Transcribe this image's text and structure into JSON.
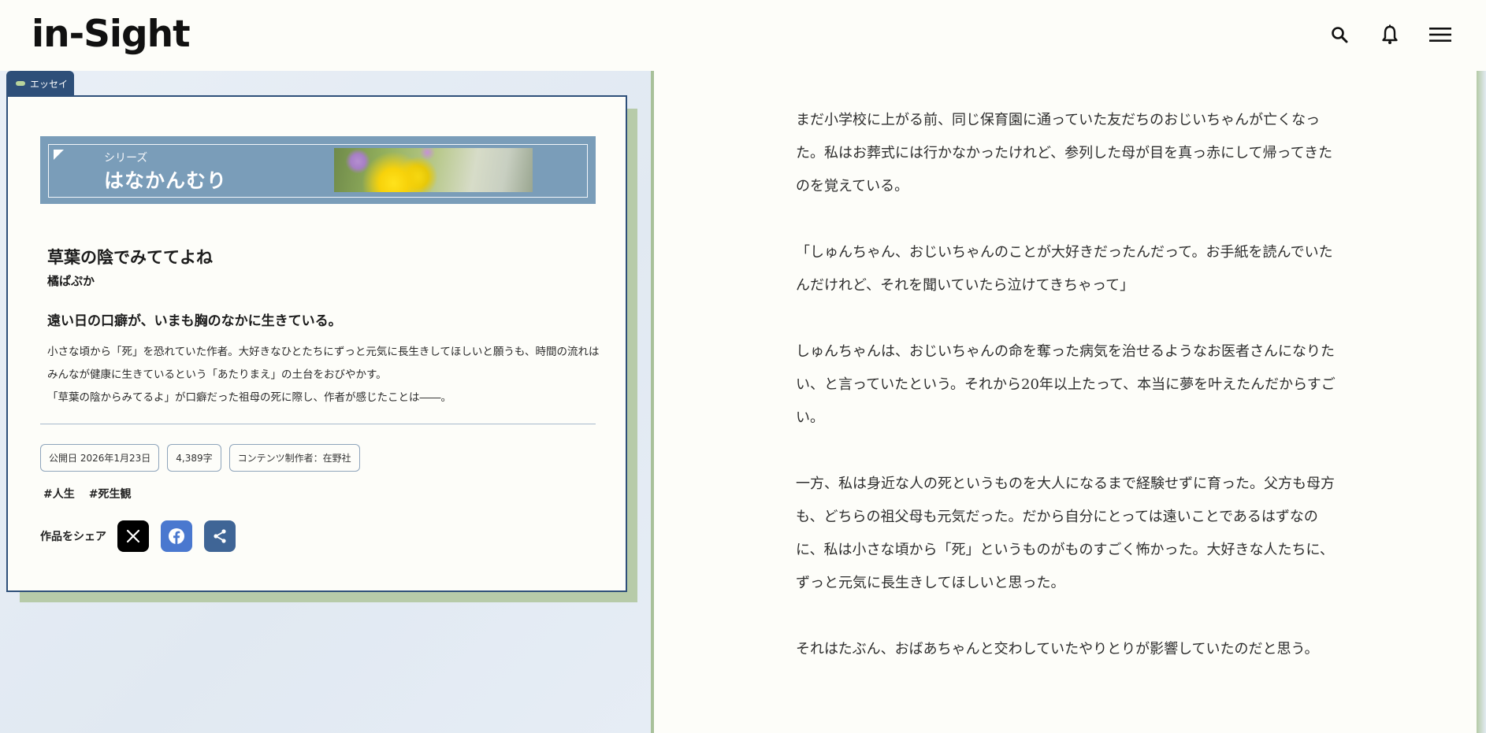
{
  "header": {
    "logo": "in-Sight",
    "icons": [
      "search-icon",
      "bell-icon",
      "menu-icon"
    ]
  },
  "category_tag": "エッセイ",
  "series": {
    "label": "シリーズ",
    "title": "はなかんむり"
  },
  "work": {
    "title": "草葉の陰でみててよね",
    "author": "橘ぱぷか",
    "catch": "遠い日の口癖が、いまも胸のなかに生きている。",
    "description": [
      "小さな頃から「死」を恐れていた作者。大好きなひとたちにずっと元気に長生きしてほしいと願うも、時間の流れはみんなが健康に生きているという「あたりまえ」の土台をおびやかす。",
      "「草葉の陰からみてるよ」が口癖だった祖母の死に際し、作者が感じたことは――。"
    ]
  },
  "meta": {
    "published": "公開日 2026年1月23日",
    "chars": "4,389字",
    "producer": "コンテンツ制作者：在野社"
  },
  "hashtags": [
    "#人生",
    "#死生観"
  ],
  "share": {
    "label": "作品をシェア",
    "buttons": [
      "x-icon",
      "facebook-icon",
      "share-icon"
    ]
  },
  "article": {
    "paragraphs": [
      "まだ小学校に上がる前、同じ保育園に通っていた友だちのおじいちゃんが亡くなった。私はお葬式には行かなかったけれど、参列した母が目を真っ赤にして帰ってきたのを覚えている。",
      "「しゅんちゃん、おじいちゃんのことが大好きだったんだって。お手紙を読んでいたんだけれど、それを聞いていたら泣けてきちゃって」",
      "しゅんちゃんは、おじいちゃんの命を奪った病気を治せるようなお医者さんになりたい、と言っていたという。それから20年以上たって、本当に夢を叶えたんだからすごい。",
      "一方、私は身近な人の死というものを大人になるまで経験せずに育った。父方も母方も、どちらの祖父母も元気だった。だから自分にとっては遠いことであるはずなのに、私は小さな頃から「死」というものがものすごく怖かった。大好きな人たちに、ずっと元気に長生きしてほしいと思った。",
      "それはたぶん、おばあちゃんと交わしていたやりとりが影響していたのだと思う。"
    ]
  },
  "colors": {
    "navy": "#2e4f79",
    "green": "#b7cba9",
    "series_bg": "#7a9db9",
    "facebook": "#4a78cf",
    "share": "#3f6596"
  }
}
